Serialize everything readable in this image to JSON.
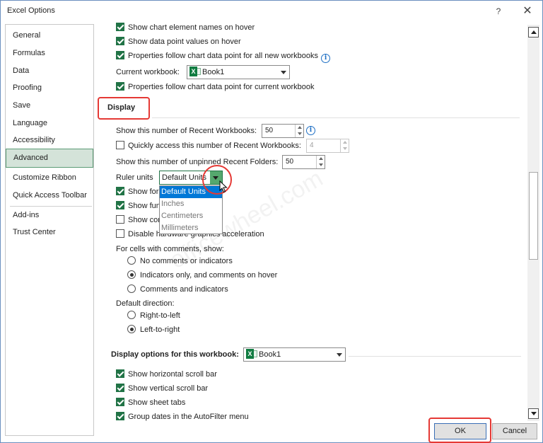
{
  "window": {
    "title": "Excel Options",
    "help_label": "?",
    "close_label": "✕"
  },
  "sidebar": {
    "items": [
      {
        "label": "General"
      },
      {
        "label": "Formulas"
      },
      {
        "label": "Data"
      },
      {
        "label": "Proofing"
      },
      {
        "label": "Save"
      },
      {
        "label": "Language"
      },
      {
        "label": "Accessibility"
      },
      {
        "label": "Advanced",
        "active": true
      },
      {
        "label": "Customize Ribbon"
      },
      {
        "label": "Quick Access Toolbar"
      },
      {
        "label": "Add-ins"
      },
      {
        "label": "Trust Center"
      }
    ]
  },
  "chart_section": {
    "show_element_names": {
      "label": "Show chart element names on hover",
      "checked": true
    },
    "show_data_point_values": {
      "label": "Show data point values on hover",
      "checked": true
    },
    "properties_all": {
      "label": "Properties follow chart data point for all new workbooks",
      "checked": true,
      "icon": "info-icon"
    },
    "current_workbook_label": "Current workbook:",
    "current_workbook_value": "Book1",
    "properties_current": {
      "label": "Properties follow chart data point for current workbook",
      "checked": true
    }
  },
  "display_section": {
    "title": "Display",
    "recent_workbooks_label": "Show this number of Recent Workbooks:",
    "recent_workbooks_value": "50",
    "quick_access": {
      "label": "Quickly access this number of Recent Workbooks:",
      "checked": false,
      "value": "4"
    },
    "unpinned_folders_label": "Show this number of unpinned Recent Folders:",
    "unpinned_folders_value": "50",
    "ruler_units_label": "Ruler units",
    "ruler_units_value": "Default Units",
    "ruler_units_options": [
      "Default Units",
      "Inches",
      "Centimeters",
      "Millimeters"
    ],
    "show_formula_bar": {
      "label": "Show formula bar",
      "checked": true
    },
    "show_function_tooltips": {
      "label": "Show function ScreenTips",
      "checked": true
    },
    "show_comments": {
      "label": "Show comments",
      "checked": false
    },
    "disable_hw_accel": {
      "label": "Disable hardware graphics acceleration",
      "checked": false
    },
    "comments_label": "For cells with comments, show:",
    "comments_options": [
      {
        "label": "No comments or indicators",
        "selected": false
      },
      {
        "label": "Indicators only, and comments on hover",
        "selected": true
      },
      {
        "label": "Comments and indicators",
        "selected": false
      }
    ],
    "direction_label": "Default direction:",
    "direction_options": [
      {
        "label": "Right-to-left",
        "selected": false
      },
      {
        "label": "Left-to-right",
        "selected": true
      }
    ]
  },
  "workbook_section": {
    "title": "Display options for this workbook:",
    "workbook_value": "Book1",
    "horizontal_scroll": {
      "label": "Show horizontal scroll bar",
      "checked": true
    },
    "vertical_scroll": {
      "label": "Show vertical scroll bar",
      "checked": true
    },
    "sheet_tabs": {
      "label": "Show sheet tabs",
      "checked": true
    },
    "group_dates": {
      "label": "Group dates in the AutoFilter menu",
      "checked": true
    }
  },
  "footer": {
    "ok_label": "OK",
    "cancel_label": "Cancel"
  },
  "colors": {
    "accent": "#217346",
    "annotation": "#e53935",
    "selection": "#0078d7"
  }
}
